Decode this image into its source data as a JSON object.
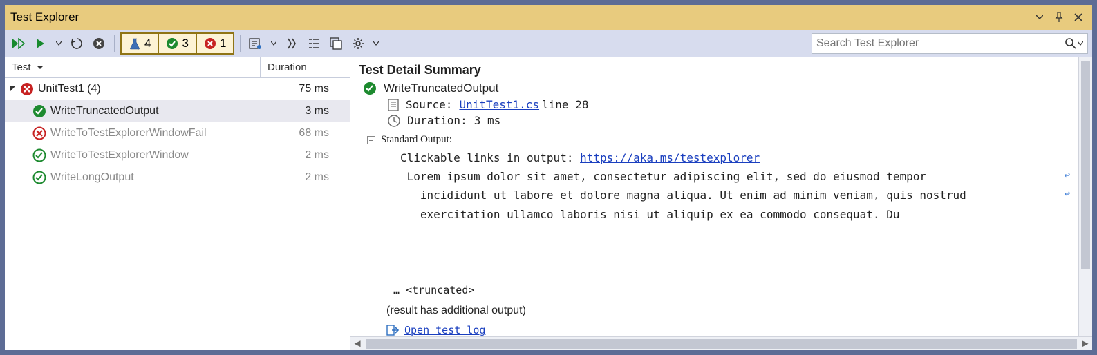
{
  "title": "Test Explorer",
  "search": {
    "placeholder": "Search Test Explorer"
  },
  "counts": {
    "total": "4",
    "passed": "3",
    "failed": "1"
  },
  "columns": {
    "test": "Test",
    "duration": "Duration"
  },
  "tree": {
    "group": {
      "name": "UnitTest1",
      "count": "(4)",
      "duration": "75 ms"
    },
    "items": [
      {
        "name": "WriteTruncatedOutput",
        "duration": "3 ms",
        "status": "pass",
        "selected": true
      },
      {
        "name": "WriteToTestExplorerWindowFail",
        "duration": "68 ms",
        "status": "fail"
      },
      {
        "name": "WriteToTestExplorerWindow",
        "duration": "2 ms",
        "status": "pass-outline"
      },
      {
        "name": "WriteLongOutput",
        "duration": "2 ms",
        "status": "pass-outline"
      }
    ]
  },
  "detail": {
    "heading": "Test Detail Summary",
    "testname": "WriteTruncatedOutput",
    "source_label": "Source:",
    "source_file": "UnitTest1.cs",
    "source_line": " line 28",
    "duration_label": "Duration:",
    "duration_value": "3 ms",
    "stdout_label": "Standard Output:",
    "out_prefix": "Clickable links in output: ",
    "out_link": "https://aka.ms/testexplorer",
    "out_body": " Lorem ipsum dolor sit amet, consectetur adipiscing elit, sed do eiusmod tempor\n   incididunt ut labore et dolore magna aliqua. Ut enim ad minim veniam, quis nostrud\n   exercitation ullamco laboris nisi ut aliquip ex ea commodo consequat. Du",
    "truncated": "… <truncated>",
    "additional": "(result has additional output)",
    "openlog": "Open test log"
  }
}
